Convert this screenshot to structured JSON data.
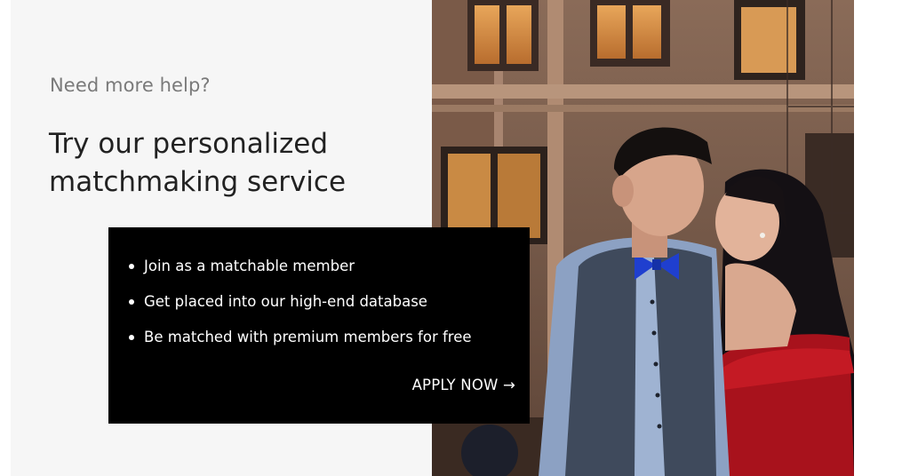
{
  "promo": {
    "kicker": "Need more help?",
    "headline": "Try our personalized matchmaking service"
  },
  "card": {
    "items": [
      {
        "label": "Join as a matchable member"
      },
      {
        "label": "Get placed into our high-end database"
      },
      {
        "label": "Be matched with premium members for free"
      }
    ],
    "cta_label": "APPLY NOW →"
  },
  "colors": {
    "panel_bg": "#f6f6f6",
    "card_bg": "#000000",
    "headline": "#222222",
    "kicker": "#7a7a7a"
  }
}
